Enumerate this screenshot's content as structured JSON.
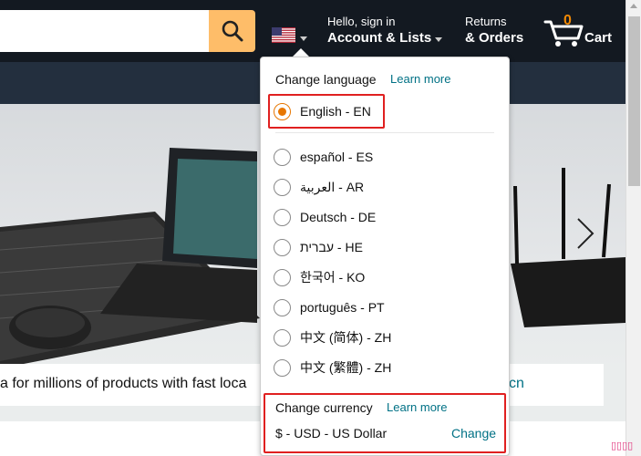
{
  "header": {
    "search_placeholder": "",
    "account_line1": "Hello, sign in",
    "account_line2": "Account & Lists",
    "returns_line1": "Returns",
    "returns_line2": "& Orders",
    "cart_count": "0",
    "cart_label": "Cart"
  },
  "language_popover": {
    "title": "Change language",
    "learn_more": "Learn more",
    "languages": [
      {
        "label": "English - EN",
        "selected": true
      },
      {
        "label": "español - ES",
        "selected": false
      },
      {
        "label": "العربية - AR",
        "selected": false
      },
      {
        "label": "Deutsch - DE",
        "selected": false
      },
      {
        "label": "עברית - HE",
        "selected": false
      },
      {
        "label": "한국어 - KO",
        "selected": false
      },
      {
        "label": "português - PT",
        "selected": false
      },
      {
        "label": "中文 (简体) - ZH",
        "selected": false
      },
      {
        "label": "中文 (繁體) - ZH",
        "selected": false
      }
    ],
    "currency_title": "Change currency",
    "currency_learn_more": "Learn more",
    "currency_value": "$ - USD - US Dollar",
    "currency_change": "Change"
  },
  "promo": {
    "text": "a for millions of products with fast loca",
    "link": "cn"
  },
  "colors": {
    "header_bg": "#131921",
    "subnav_bg": "#232f3e",
    "search_button": "#febd69",
    "link": "#007185",
    "radio_selected": "#e77600",
    "highlight_border": "#e02020",
    "cart_count": "#f08804"
  },
  "watermark": "▯▯▯▯"
}
